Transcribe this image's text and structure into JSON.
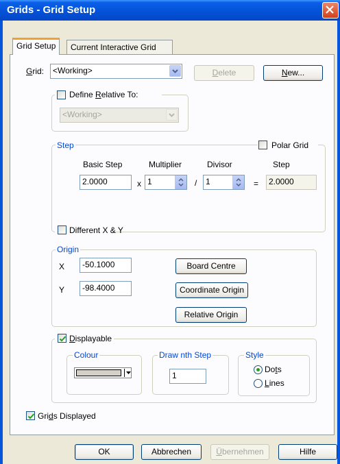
{
  "window": {
    "title": "Grids - Grid Setup"
  },
  "tabs": [
    "Grid Setup",
    "Current Interactive Grid"
  ],
  "grid": {
    "label": "Grid:",
    "selected": "<Working>",
    "delete_label": "Delete",
    "new_label": "New..."
  },
  "define_relative": {
    "label": "Define Relative To:",
    "checked": false,
    "selected": "<Working>"
  },
  "step": {
    "legend": "Step",
    "polar_label": "Polar Grid",
    "headers": {
      "basic": "Basic Step",
      "multiplier": "Multiplier",
      "divisor": "Divisor",
      "step": "Step"
    },
    "basic_value": "2.0000",
    "times": "x",
    "multiplier_value": "1",
    "slash": "/",
    "divisor_value": "1",
    "equals": "=",
    "result_value": "2.0000",
    "different_xy_label": "Different X & Y"
  },
  "origin": {
    "legend": "Origin",
    "x_label": "X",
    "x_value": "-50.1000",
    "y_label": "Y",
    "y_value": "-98.4000",
    "board_centre": "Board Centre",
    "coordinate_origin": "Coordinate Origin",
    "relative_origin": "Relative Origin"
  },
  "display": {
    "displayable_label": "Displayable",
    "displayable_checked": true,
    "colour_legend": "Colour",
    "colour_value": "#D4D0C8",
    "nth_legend": "Draw nth Step",
    "nth_value": "1",
    "style_legend": "Style",
    "style_options": [
      "Dots",
      "Lines"
    ],
    "style_selected": "Dots"
  },
  "grids_displayed_label": "Grids Displayed",
  "grids_displayed_checked": true,
  "footer": {
    "ok": "OK",
    "cancel": "Abbrechen",
    "apply": "Übernehmen",
    "help": "Hilfe"
  },
  "colors": {
    "accent_blue": "#0046D5",
    "title_blue": "#0452D8",
    "check_green": "#21A121"
  }
}
